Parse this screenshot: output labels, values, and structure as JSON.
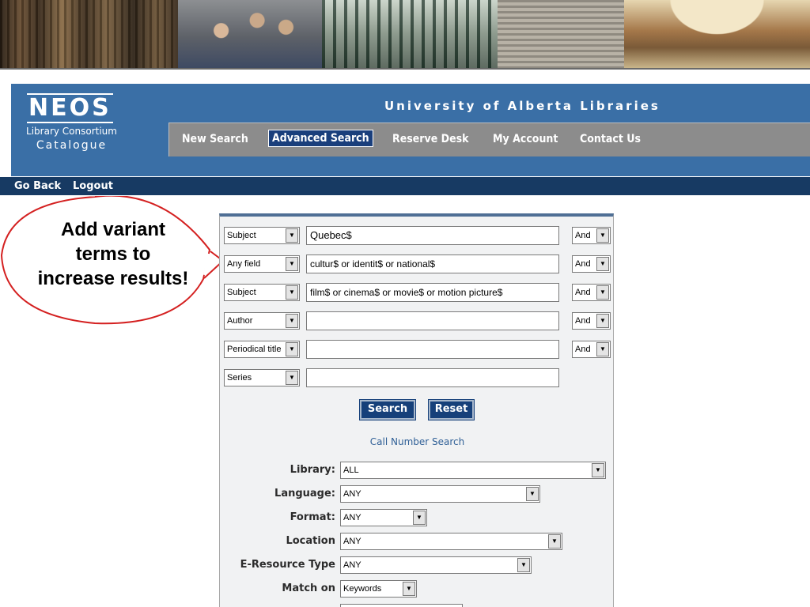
{
  "header": {
    "logo_title": "NEOS",
    "logo_line1": "Library Consortium",
    "logo_line2": "Catalogue",
    "university": "University of Alberta Libraries",
    "nav": [
      "New Search",
      "Advanced Search",
      "Reserve Desk",
      "My Account",
      "Contact Us"
    ],
    "active_nav": "Advanced Search"
  },
  "links": [
    "Go Back",
    "Logout"
  ],
  "callout": {
    "line1": "Add variant",
    "line2": "terms to",
    "line3": "increase results!"
  },
  "search_rows": [
    {
      "field": "Subject",
      "term": "Quebec$",
      "bool": "And"
    },
    {
      "field": "Any field",
      "term": "cultur$ or identit$ or national$",
      "bool": "And"
    },
    {
      "field": "Subject",
      "term": "film$ or cinema$ or movie$ or motion picture$",
      "bool": "And"
    },
    {
      "field": "Author",
      "term": "",
      "bool": "And"
    },
    {
      "field": "Periodical title",
      "term": "",
      "bool": "And"
    },
    {
      "field": "Series",
      "term": "",
      "bool": ""
    }
  ],
  "buttons": {
    "search": "Search",
    "reset": "Reset"
  },
  "call_number_link": "Call Number Search",
  "limits": [
    {
      "label": "Library:",
      "value": "ALL"
    },
    {
      "label": "Language:",
      "value": "ANY"
    },
    {
      "label": "Format:",
      "value": "ANY"
    },
    {
      "label": "Location",
      "value": "ANY"
    },
    {
      "label": "E-Resource Type",
      "value": "ANY"
    },
    {
      "label": "Match on",
      "value": "Keywords"
    }
  ],
  "icons": {
    "dropdown": "▼"
  },
  "colors": {
    "header_blue": "#3a6fa6",
    "nav_gray": "#8c8c8c",
    "linkbar_navy": "#173a63",
    "button_navy": "#16407a",
    "callout_border": "#d42020"
  }
}
